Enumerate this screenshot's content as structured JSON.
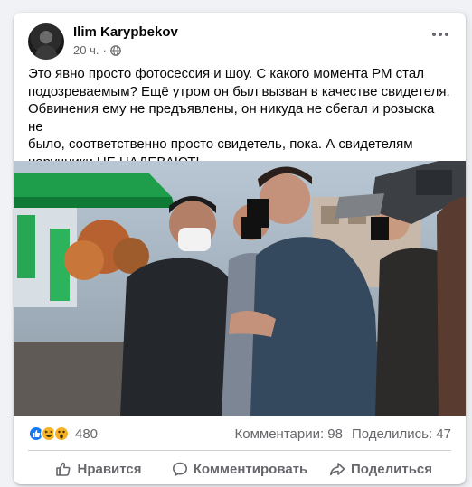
{
  "post": {
    "author": "Ilim Karypbekov",
    "time": "20 ч.",
    "separator": "·",
    "text_lines": [
      "Это явно просто фотосессия и шоу. С какого момента РМ стал",
      "подозреваемым? Ещё утром он был вызван в качестве свидетеля.",
      "Обвинения ему не предъявлены, он никуда не сбегал и розыска не",
      "было, соответственно просто свидетель, пока. А свидетелям",
      "наручники НЕ НАДЕВАЮТ!"
    ]
  },
  "reactions": {
    "icons": [
      "like-icon",
      "haha-icon",
      "wow-icon"
    ],
    "count": "480",
    "comments": "Комментарии: 98",
    "shares": "Поделились: 47"
  },
  "actions": {
    "like": "Нравится",
    "comment": "Комментировать",
    "share": "Поделиться"
  },
  "colors": {
    "like_blue": "#1877f2",
    "haha_yellow": "#f7b125",
    "muted_text": "#65676b",
    "photo_green": "#1e9e4a"
  }
}
